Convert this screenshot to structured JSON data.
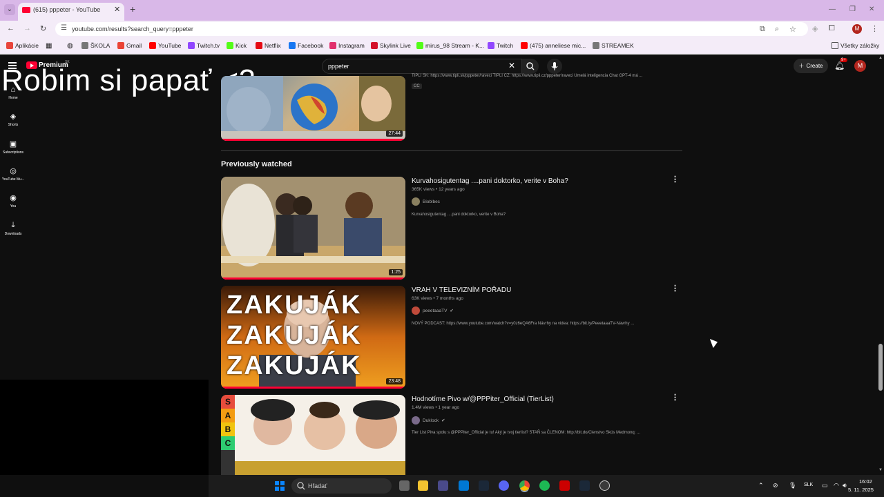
{
  "browser": {
    "tab_title": "(615) pppeter - YouTube",
    "url": "youtube.com/results?search_query=pppeter",
    "bookmarks": [
      {
        "label": "Aplikácie",
        "color": "#e8453c"
      },
      {
        "label": "ŠKOLA",
        "color": "#777777"
      },
      {
        "label": "Gmail",
        "color": "#ea4335"
      },
      {
        "label": "YouTube",
        "color": "#ff0000"
      },
      {
        "label": "Twitch.tv",
        "color": "#9146ff"
      },
      {
        "label": "Kick",
        "color": "#53fc18"
      },
      {
        "label": "Netflix",
        "color": "#e50914"
      },
      {
        "label": "Facebook",
        "color": "#1877f2"
      },
      {
        "label": "Instagram",
        "color": "#e1306c"
      },
      {
        "label": "Skylink Live",
        "color": "#d4122a"
      },
      {
        "label": "mirus_98 Stream - K...",
        "color": "#53fc18"
      },
      {
        "label": "Twitch",
        "color": "#9146ff"
      },
      {
        "label": "(475) anneliese mic...",
        "color": "#ff0000"
      },
      {
        "label": "STREAMEK",
        "color": "#777777"
      }
    ],
    "all_bookmarks_label": "Všetky záložky"
  },
  "youtube": {
    "brand": "Premium",
    "country": "SK",
    "overlay_text": "Robim si papať <3",
    "search_query": "pppeter",
    "create_label": "Create",
    "notif_count": "9+",
    "avatar_letter": "M",
    "sidebar": [
      {
        "label": "Home",
        "icon": "home-icon",
        "glyph": "⌂"
      },
      {
        "label": "Shorts",
        "icon": "shorts-icon",
        "glyph": "◈"
      },
      {
        "label": "Subscriptions",
        "icon": "subscriptions-icon",
        "glyph": "▣"
      },
      {
        "label": "YouTube Mu...",
        "icon": "music-icon",
        "glyph": "◎"
      },
      {
        "label": "You",
        "icon": "you-icon",
        "glyph": "◉"
      },
      {
        "label": "Downloads",
        "icon": "download-icon",
        "glyph": "⤓"
      }
    ],
    "top_video": {
      "duration": "27:44",
      "desc": "TIPLI SK: https://www.tipli.sk/pppeter/raveci TIPLI CZ: https://www.tipli.cz/pppeter/raveci Umelá inteligencia Chat GPT-4 má ...",
      "badge": "CC"
    },
    "section_title": "Previously watched",
    "videos": [
      {
        "title": "Kurvahosigutentag ....pani doktorko, verite v Boha?",
        "meta": "365K views • 12 years ago",
        "channel": "Bioblbec",
        "desc": "Kurvahosigutentag ....pani doktorko, verite v Boha?",
        "duration": "1:25"
      },
      {
        "title": "VRAH V TELEVIZNÍM POŘADU",
        "meta": "63K views • 7 months ago",
        "channel": "peeetaaaTV",
        "desc": "NOVÝ PODCAST: https://www.youtube.com/watch?v=y0z6eQA6Fra Návrhy na videa: https://bit.ly/PeeetaaaTV-Navrhy ...",
        "duration": "23:48"
      },
      {
        "title": "Hodnotíme Pivo w/@PPPiter_Official (TierList)",
        "meta": "1.4M views • 1 year ago",
        "channel": "Duklock",
        "desc": "Tier List Piva spolu s @PPPiter_Official je tu! Aký je tvoj tierlist? STAŇ sa ČLENOM: http://bit.do/Clenstvo Skús Medmonq: ...",
        "duration": ""
      }
    ],
    "thumb2_text": [
      "ZAKUJÁK",
      "ZAKUJÁK",
      "ZAKUJÁK"
    ],
    "thumb3_tiers": [
      "S",
      "A",
      "B",
      "C"
    ]
  },
  "taskbar": {
    "search_placeholder": "Hľadať",
    "lang": "SLK",
    "time": "16:02",
    "date": "5. 11. 2025"
  }
}
